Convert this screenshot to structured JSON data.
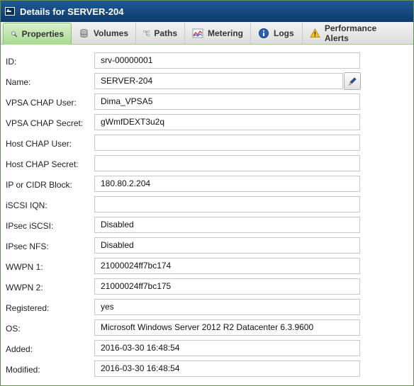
{
  "window": {
    "title": "Details for SERVER-204"
  },
  "tabs": [
    {
      "label": "Properties",
      "icon": "magnifier-icon",
      "active": true
    },
    {
      "label": "Volumes",
      "icon": "database-icon",
      "active": false
    },
    {
      "label": "Paths",
      "icon": "paths-icon",
      "active": false
    },
    {
      "label": "Metering",
      "icon": "chart-icon",
      "active": false
    },
    {
      "label": "Logs",
      "icon": "info-icon",
      "active": false
    },
    {
      "label": "Performance Alerts",
      "icon": "warning-icon",
      "active": false
    }
  ],
  "properties": {
    "id": {
      "label": "ID:",
      "value": "srv-00000001"
    },
    "name": {
      "label": "Name:",
      "value": "SERVER-204"
    },
    "vpsa_chap_user": {
      "label": "VPSA CHAP User:",
      "value": "Dima_VPSA5"
    },
    "vpsa_chap_secret": {
      "label": "VPSA CHAP Secret:",
      "value": "gWmfDEXT3u2q"
    },
    "host_chap_user": {
      "label": "Host CHAP User:",
      "value": ""
    },
    "host_chap_secret": {
      "label": "Host CHAP Secret:",
      "value": ""
    },
    "ip_cidr": {
      "label": "IP or CIDR Block:",
      "value": "180.80.2.204"
    },
    "iscsi_iqn": {
      "label": "iSCSI IQN:",
      "value": ""
    },
    "ipsec_iscsi": {
      "label": "IPsec iSCSI:",
      "value": "Disabled"
    },
    "ipsec_nfs": {
      "label": "IPsec NFS:",
      "value": "Disabled"
    },
    "wwpn1": {
      "label": "WWPN 1:",
      "value": "21000024ff7bc174"
    },
    "wwpn2": {
      "label": "WWPN 2:",
      "value": "21000024ff7bc175"
    },
    "registered": {
      "label": "Registered:",
      "value": "yes"
    },
    "os": {
      "label": "OS:",
      "value": "Microsoft Windows Server 2012 R2 Datacenter 6.3.9600"
    },
    "added": {
      "label": "Added:",
      "value": "2016-03-30 16:48:54"
    },
    "modified": {
      "label": "Modified:",
      "value": "2016-03-30 16:48:54"
    }
  },
  "colors": {
    "titlebar": "#164a82",
    "active_tab": "#a8d98f"
  }
}
